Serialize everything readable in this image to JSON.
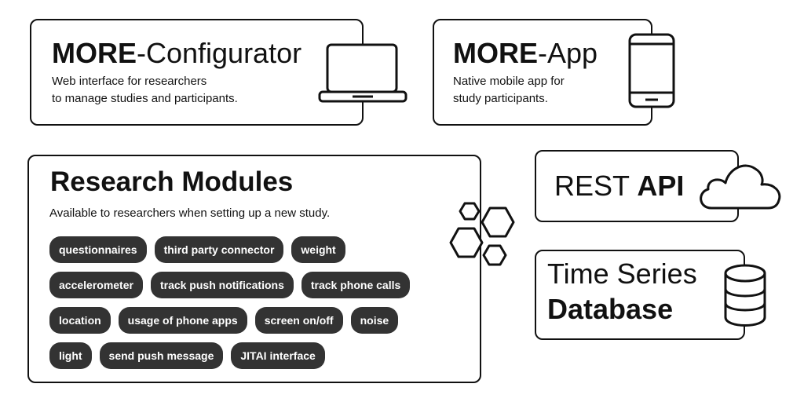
{
  "configurator": {
    "title_bold": "MORE",
    "title_rest": "-Configurator",
    "desc": [
      "Web interface for researchers",
      "to manage studies and participants."
    ],
    "icon": "laptop-icon"
  },
  "app": {
    "title_bold": "MORE",
    "title_rest": "-App",
    "desc": [
      "Native mobile app for",
      "study participants."
    ],
    "icon": "smartphone-icon"
  },
  "modules": {
    "title": "Research Modules",
    "desc": "Available to researchers when setting up a new study.",
    "icon": "hexagons-icon",
    "rows": [
      [
        "questionnaires",
        "third party connector",
        "weight"
      ],
      [
        "accelerometer",
        "track push notifications",
        "track phone calls"
      ],
      [
        "location",
        "usage of phone apps",
        "screen on/off",
        "noise"
      ],
      [
        "light",
        "send push message",
        "JITAI interface"
      ]
    ]
  },
  "api": {
    "title_rest": "REST ",
    "title_bold": "API",
    "icon": "cloud-icon"
  },
  "db": {
    "line1": "Time Series",
    "line2": "Database",
    "icon": "database-icon"
  },
  "colors": {
    "chip_bg": "#333333",
    "stroke": "#111111"
  }
}
